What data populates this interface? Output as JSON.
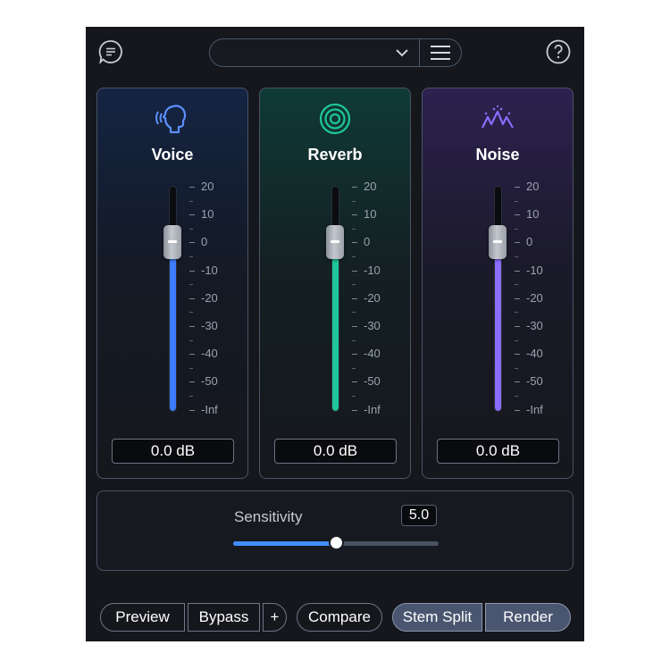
{
  "header": {
    "chat_icon": "chat-bubble-icon",
    "preset_value": "",
    "chevron_icon": "chevron-down-icon",
    "menu_icon": "hamburger-menu-icon",
    "help_icon": "help-question-icon"
  },
  "scale_labels": [
    "20",
    "10",
    "0",
    "-10",
    "-20",
    "-30",
    "-40",
    "-50",
    "-Inf"
  ],
  "panels": [
    {
      "title": "Voice",
      "icon": "speaking-head-icon",
      "value": "0.0 dB",
      "level_db": 0,
      "color": "#3d7bff"
    },
    {
      "title": "Reverb",
      "icon": "concentric-circles-icon",
      "value": "0.0 dB",
      "level_db": 0,
      "color": "#1fc69b"
    },
    {
      "title": "Noise",
      "icon": "noise-peaks-icon",
      "value": "0.0 dB",
      "level_db": 0,
      "color": "#8a6cff"
    }
  ],
  "sensitivity": {
    "label": "Sensitivity",
    "value": "5.0",
    "min": 0,
    "max": 10,
    "accent": "#3f8fff"
  },
  "footer": {
    "preview": "Preview",
    "bypass": "Bypass",
    "plus": "+",
    "compare": "Compare",
    "stem_split": "Stem Split",
    "render": "Render"
  }
}
